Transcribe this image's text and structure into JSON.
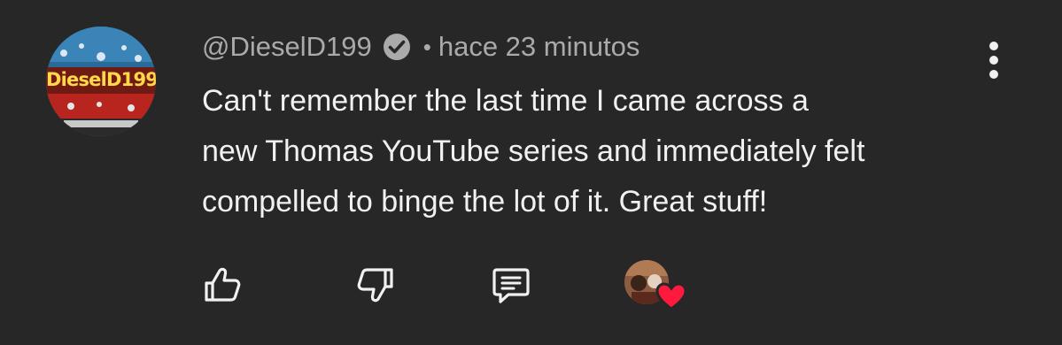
{
  "comment": {
    "author": "@DieselD199",
    "avatar_text": "DieselD199",
    "separator": "•",
    "timestamp": "hace 23 minutos",
    "text_lines": [
      "Can't remember the last time I came across a",
      "new Thomas YouTube series and immediately felt",
      "compelled to binge the lot of it. Great stuff!"
    ]
  },
  "icons": {
    "verified": "verified-check-icon",
    "menu": "more-vert-icon",
    "like": "thumbs-up-icon",
    "dislike": "thumbs-down-icon",
    "reply": "reply-comment-icon",
    "heart": "creator-heart-icon"
  },
  "colors": {
    "background": "#272727",
    "text_primary": "#f1f1f1",
    "text_secondary": "#aaaaaa",
    "heart": "#ff1a3d"
  }
}
